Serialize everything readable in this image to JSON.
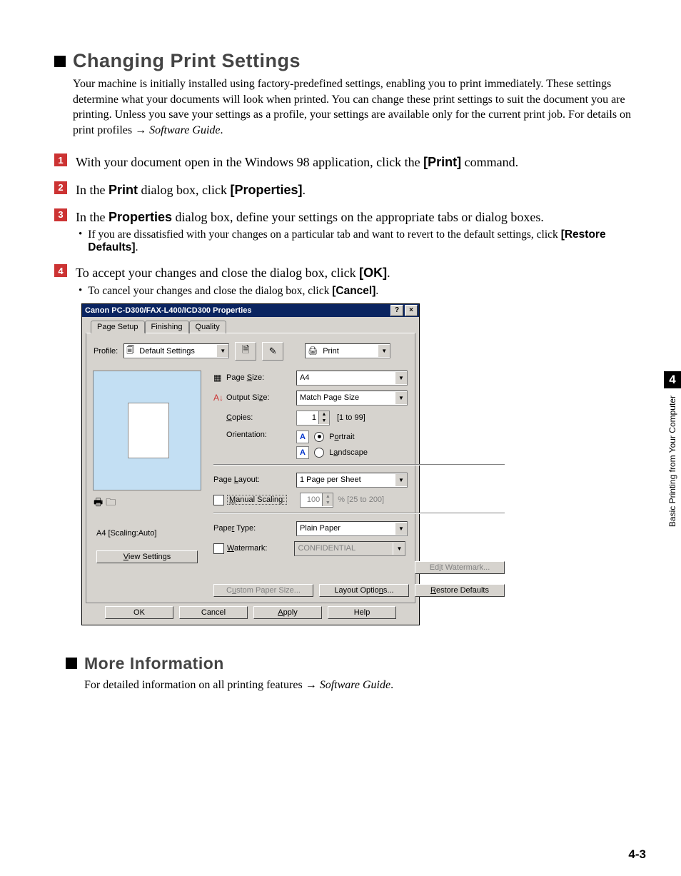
{
  "heading1": "Changing Print Settings",
  "intro_a": "Your machine is initially installed using factory-predefined settings, enabling you to print immediately. These settings determine what your documents will look when printed. You can change these print settings to suit the document you are printing. Unless you save your settings as a profile, your settings are available only for the current print job. For details on print profiles → ",
  "intro_b": "Software Guide",
  "intro_c": ".",
  "step1_a": "With your document open in the Windows 98 application, click the ",
  "step1_b": "[Print]",
  "step1_c": " command.",
  "step2_a": "In the ",
  "step2_b": "Print",
  "step2_c": " dialog box, click ",
  "step2_d": "[Properties]",
  "step2_e": ".",
  "step3_a": "In the ",
  "step3_b": "Properties",
  "step3_c": " dialog box, define your settings on the appropriate tabs or dialog boxes.",
  "step3_sub_a": "If you are dissatisfied with your changes on a particular tab and want to revert to the default settings, click ",
  "step3_sub_b": "[Restore Defaults]",
  "step3_sub_c": ".",
  "step4_a": "To accept your changes and close the dialog box, click ",
  "step4_b": "[OK]",
  "step4_c": ".",
  "step4_sub_a": "To cancel your changes and close the dialog box, click ",
  "step4_sub_b": "[Cancel]",
  "step4_sub_c": ".",
  "heading2": "More Information",
  "more_a": "For detailed information on all printing features → ",
  "more_b": "Software Guide",
  "more_c": ".",
  "side_chapter": "4",
  "side_label": "Basic Printing from Your Computer",
  "page_num": "4-3",
  "dlg": {
    "title": "Canon PC-D300/FAX-L400/ICD300 Properties",
    "tabs": {
      "page_setup": "Page Setup",
      "finishing": "Finishing",
      "quality": "Quality"
    },
    "profile_label": "Profile:",
    "profile_value": "Default Settings",
    "output_method_value": "Print",
    "page_size_label": "Page Size:",
    "page_size_value": "A4",
    "output_size_label": "Output Size:",
    "output_size_value": "Match Page Size",
    "copies_label": "Copies:",
    "copies_value": "1",
    "copies_range": "[1 to 99]",
    "orientation_label": "Orientation:",
    "portrait": "Portrait",
    "landscape": "Landscape",
    "page_layout_label": "Page Layout:",
    "page_layout_value": "1 Page per Sheet",
    "manual_scaling_label": "Manual Scaling:",
    "scaling_value": "100",
    "scaling_range": "% [25 to 200]",
    "paper_type_label": "Paper Type:",
    "paper_type_value": "Plain Paper",
    "watermark_label": "Watermark:",
    "watermark_value": "CONFIDENTIAL",
    "edit_watermark": "Edit Watermark...",
    "preview_caption": "A4 [Scaling:Auto]",
    "view_settings": "View Settings",
    "custom_paper": "Custom Paper Size...",
    "layout_options": "Layout Options...",
    "restore_defaults": "Restore Defaults",
    "ok": "OK",
    "cancel": "Cancel",
    "apply": "Apply",
    "help": "Help"
  }
}
